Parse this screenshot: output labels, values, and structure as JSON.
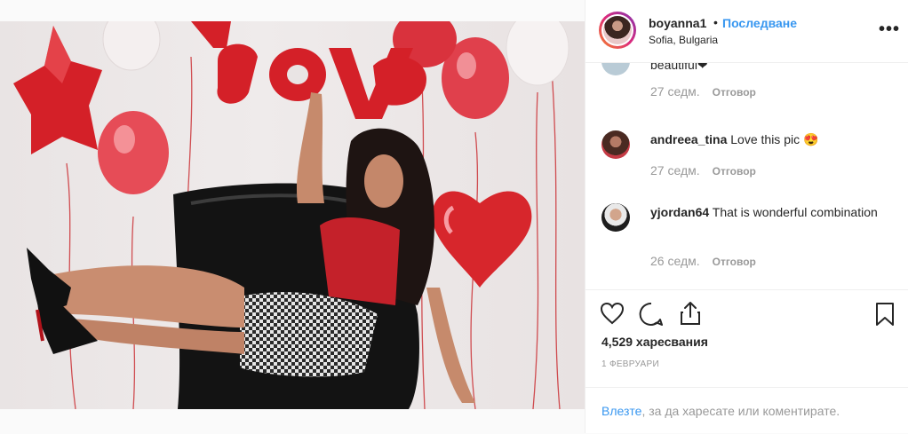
{
  "post": {
    "username": "boyanna1",
    "separator": "•",
    "follow_label": "Последване",
    "location": "Sofia, Bulgaria",
    "more_icon": "more-options-icon"
  },
  "comments": [
    {
      "username": "",
      "text": "beautiful❤",
      "age": "27 седм.",
      "reply_label": "Отговор"
    },
    {
      "username": "andreea_tina",
      "text": "Love this pic 😍",
      "age": "27 седм.",
      "reply_label": "Отговор"
    },
    {
      "username": "yjordan64",
      "text": "That is wonderful combination",
      "age": "26 седм.",
      "reply_label": "Отговор"
    }
  ],
  "actions": {
    "like_icon": "heart-icon",
    "comment_icon": "comment-icon",
    "share_icon": "share-icon",
    "save_icon": "bookmark-icon",
    "likes": "4,529 харесвания",
    "date": "1 февруари"
  },
  "login": {
    "link": "Влезте",
    "rest": ", за да харесате или коментирате."
  },
  "colors": {
    "link": "#3897f0",
    "text": "#262626",
    "muted": "#999999",
    "balloon_red": "#d7262c"
  }
}
